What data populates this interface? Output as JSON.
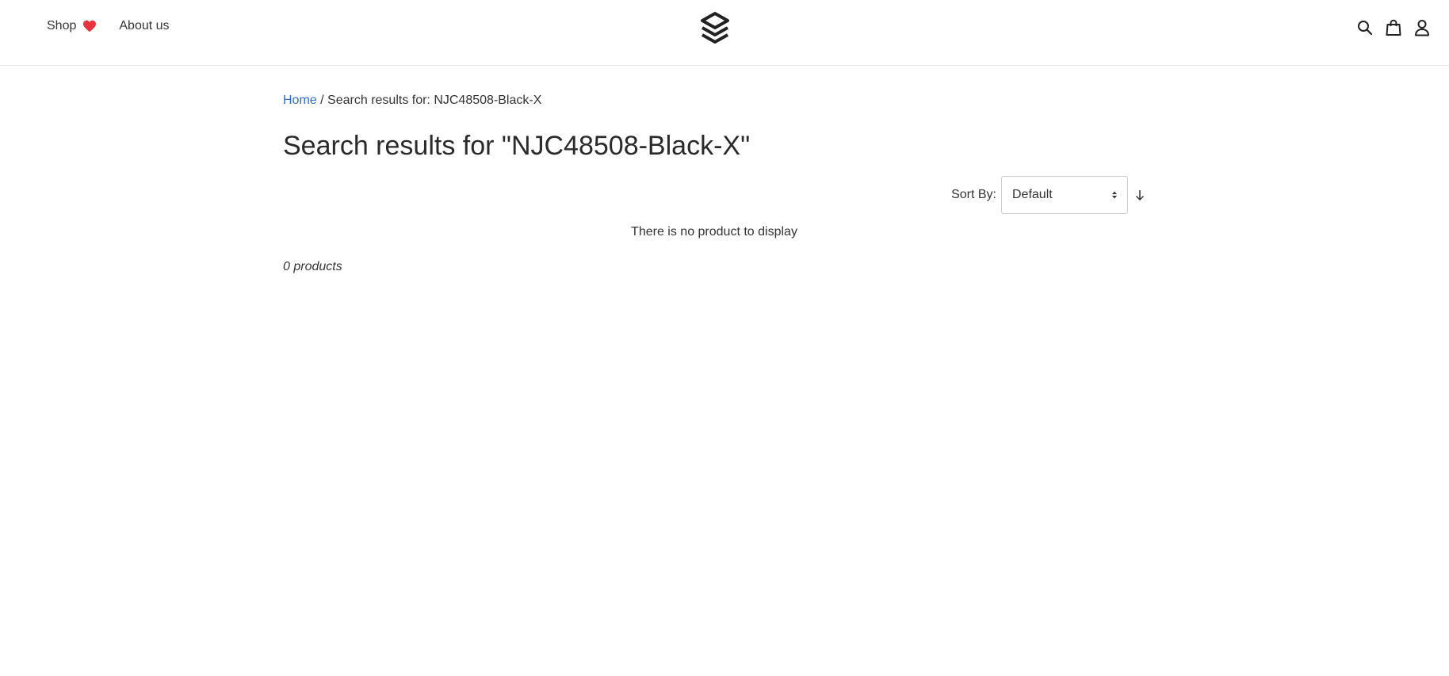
{
  "header": {
    "nav": [
      {
        "label": "Shop",
        "icon": "heart-icon"
      },
      {
        "label": "About us"
      }
    ],
    "logo": "layers-logo",
    "actions": [
      "search-icon",
      "shopping-bag-icon",
      "user-icon"
    ]
  },
  "breadcrumb": {
    "home": "Home",
    "separator": "/",
    "current": "Search results for: NJC48508-Black-X"
  },
  "page": {
    "title": "Search results for \"NJC48508-Black-X\""
  },
  "sort": {
    "label": "Sort By:",
    "selected": "Default",
    "direction_icon": "arrow-down-icon"
  },
  "results": {
    "empty_message": "There is no product to display",
    "count_text": "0 products"
  },
  "colors": {
    "link": "#2c6ecb",
    "heart": "#e8343f",
    "text": "#333333"
  }
}
